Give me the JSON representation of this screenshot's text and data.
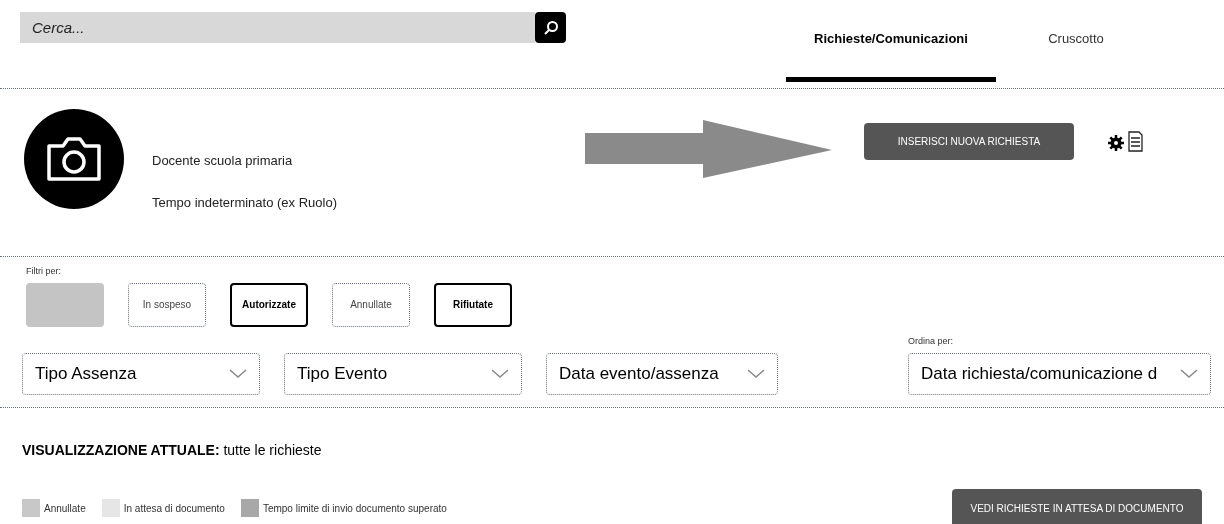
{
  "search": {
    "placeholder": "Cerca..."
  },
  "tabs": [
    {
      "label": "Richieste/Comunicazioni",
      "selected": true
    },
    {
      "label": "Cruscotto",
      "selected": false
    }
  ],
  "profile": {
    "role": "Docente scuola primaria",
    "contract": "Tempo indeterminato (ex Ruolo)"
  },
  "new_request_button": "INSERISCI NUOVA RICHIESTA",
  "filters": {
    "label": "Filtri per:",
    "chips": [
      {
        "selected": true,
        "bold": false
      },
      {
        "label": "In sospeso",
        "selected": false,
        "bold": false
      },
      {
        "label": "Autorizzate",
        "selected": false,
        "bold": true
      },
      {
        "label": "Annullate",
        "selected": false,
        "bold": false
      },
      {
        "label": "Rifiutate",
        "selected": false,
        "bold": true
      }
    ]
  },
  "dropdowns": [
    {
      "value": "Tipo Assenza"
    },
    {
      "value": "Tipo Evento"
    },
    {
      "value": "Data evento/assenza"
    }
  ],
  "sort": {
    "label": "Ordina per:",
    "value": "Data richiesta/comunicazione d"
  },
  "current_view": "**VISUALIZZAZIONE ATTUALE:** tutte le richieste",
  "legend": [
    {
      "label": "Annullate",
      "color": "#c8c8c8"
    },
    {
      "label": "In attesa di documento",
      "color": "#e6e6e6"
    },
    {
      "label": "Tempo limite di invio documento superato",
      "color": "#a8a8a8"
    }
  ],
  "pending_button": "VEDI RICHIESTE IN ATTESA DI DOCUMENTO"
}
